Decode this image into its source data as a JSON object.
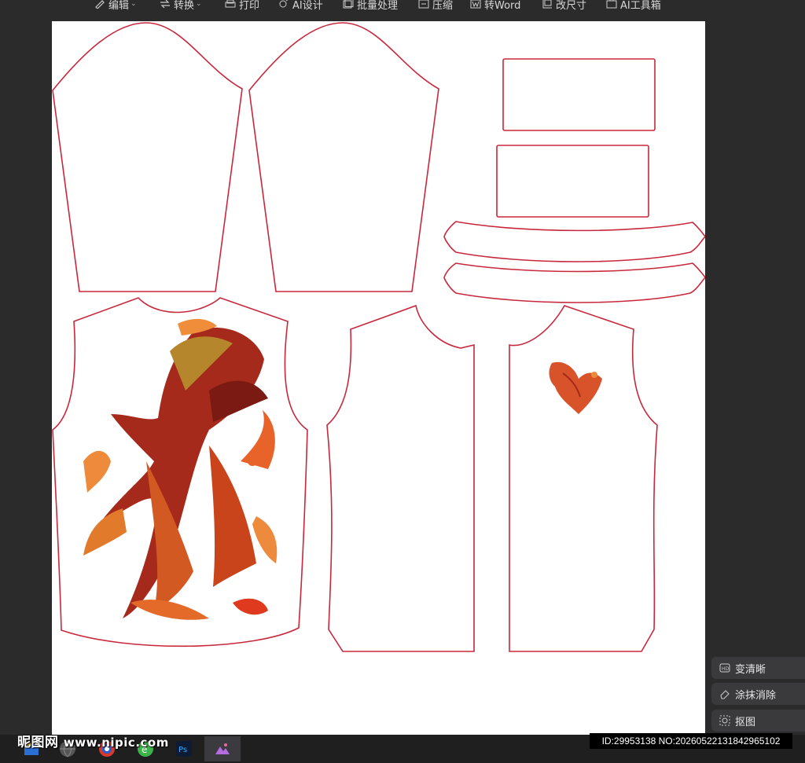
{
  "toolbar": {
    "items": [
      {
        "label": "编辑",
        "icon": "edit-icon",
        "caret": true
      },
      {
        "label": "转换",
        "icon": "convert-icon",
        "caret": true
      },
      {
        "label": "打印",
        "icon": "print-icon",
        "caret": false
      },
      {
        "label": "AI设计",
        "icon": "ai-design-icon",
        "caret": false
      },
      {
        "label": "批量处理",
        "icon": "batch-icon",
        "caret": false
      },
      {
        "label": "压缩",
        "icon": "compress-icon",
        "caret": false
      },
      {
        "label": "转Word",
        "icon": "word-icon",
        "caret": false
      },
      {
        "label": "改尺寸",
        "icon": "resize-icon",
        "caret": false
      },
      {
        "label": "AI工具箱",
        "icon": "ai-toolbox-icon",
        "caret": false
      }
    ]
  },
  "side_panel": {
    "enhance": "变清晰",
    "erase": "涂抹消除",
    "cutout": "抠图"
  },
  "watermark": {
    "site_name": "昵图网",
    "url": "www.nipic.com"
  },
  "image_id": "ID:29953138 NO:20260522131842965102",
  "colors": {
    "outline": "#c8283c",
    "canvas": "#ffffff",
    "background": "#2b2b2b"
  }
}
